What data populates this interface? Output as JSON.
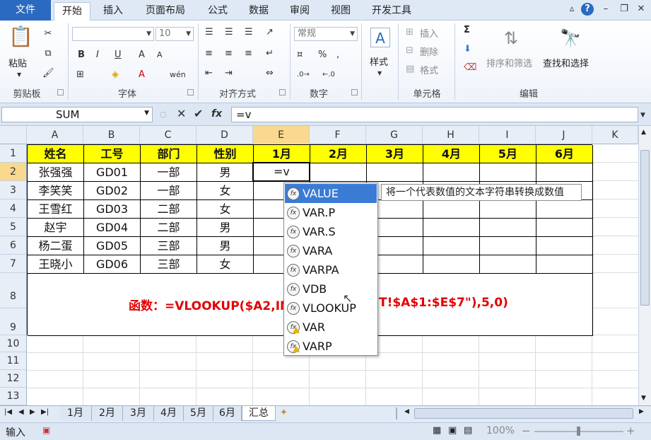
{
  "ribbon_tabs": [
    "文件",
    "开始",
    "插入",
    "页面布局",
    "公式",
    "数据",
    "审阅",
    "视图",
    "开发工具"
  ],
  "ribbon": {
    "clipboard": {
      "paste": "粘贴",
      "label": "剪贴板"
    },
    "font": {
      "size": "10",
      "label": "字体"
    },
    "align": {
      "label": "对齐方式"
    },
    "number": {
      "format": "常规",
      "label": "数字"
    },
    "styles": {
      "label": "样式"
    },
    "cells": {
      "insert": "插入",
      "delete": "删除",
      "format": "格式",
      "label": "单元格"
    },
    "editing": {
      "sum": "Σ",
      "sort": "排序和筛选",
      "find": "查找和选择",
      "label": "编辑"
    }
  },
  "formula_bar": {
    "name_box": "SUM",
    "fx": "fx",
    "content": "=v"
  },
  "columns": [
    "A",
    "B",
    "C",
    "D",
    "E",
    "F",
    "G",
    "H",
    "I",
    "J",
    "K"
  ],
  "rows": [
    "1",
    "2",
    "3",
    "4",
    "5",
    "6",
    "7",
    "8",
    "9",
    "10",
    "11",
    "12",
    "13"
  ],
  "table": {
    "headers": [
      "姓名",
      "工号",
      "部门",
      "性别",
      "1月",
      "2月",
      "3月",
      "4月",
      "5月",
      "6月"
    ],
    "data": [
      [
        "张强强",
        "GD01",
        "一部",
        "男"
      ],
      [
        "李笑笑",
        "GD02",
        "一部",
        "女"
      ],
      [
        "王雪红",
        "GD03",
        "二部",
        "女"
      ],
      [
        "赵宇",
        "GD04",
        "二部",
        "男"
      ],
      [
        "杨二蛋",
        "GD05",
        "三部",
        "男"
      ],
      [
        "王晓小",
        "GD06",
        "三部",
        "女"
      ]
    ],
    "active_cell_text": "=v",
    "note_left": "函数：=VLOOKUP($A2,IN",
    "note_right": "T!$A$1:$E$7\"),5,0)"
  },
  "autocomplete": {
    "items": [
      {
        "label": "VALUE",
        "warn": false
      },
      {
        "label": "VAR.P",
        "warn": false
      },
      {
        "label": "VAR.S",
        "warn": false
      },
      {
        "label": "VARA",
        "warn": false
      },
      {
        "label": "VARPA",
        "warn": false
      },
      {
        "label": "VDB",
        "warn": false
      },
      {
        "label": "VLOOKUP",
        "warn": false
      },
      {
        "label": "VAR",
        "warn": true
      },
      {
        "label": "VARP",
        "warn": true
      }
    ],
    "tooltip": "将一个代表数值的文本字符串转换成数值"
  },
  "sheet_tabs": [
    "1月",
    "2月",
    "3月",
    "4月",
    "5月",
    "6月",
    "汇总"
  ],
  "active_sheet": "汇总",
  "status": {
    "mode": "输入",
    "zoom": "100%"
  }
}
